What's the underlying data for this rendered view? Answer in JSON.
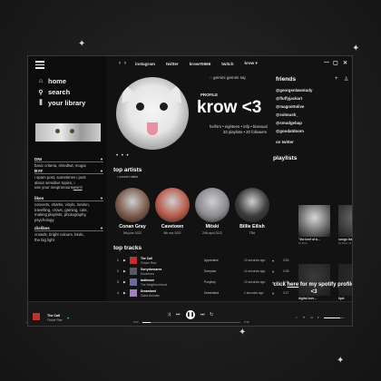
{
  "sidebar": {
    "nav": [
      {
        "label": "home",
        "icon": "home-icon"
      },
      {
        "label": "search",
        "icon": "search-icon"
      },
      {
        "label": "your library",
        "icon": "library-icon"
      }
    ],
    "sections": [
      {
        "title": "DNI",
        "lines": [
          "basic criteria, sh/edtwt, mogai"
        ]
      },
      {
        "title": "BYF",
        "lines": [
          "i spam post, sometimes i post",
          "about sensitive topics, i ",
          "use your neopronouns"
        ],
        "link": "won't"
      },
      {
        "title": "likes",
        "lines": [
          "concerts, sharks, vinyls, london,",
          "travelling, crows, gaming, cats,",
          "making playlists, photography,",
          "psychology"
        ]
      },
      {
        "title": "dislikes",
        "lines": [
          "crowds, bright colours, birds,",
          "the big light"
        ]
      }
    ]
  },
  "topbar": {
    "links": [
      "instagram",
      "twitter",
      "krow#0666",
      "twitch",
      "krow"
    ]
  },
  "profile": {
    "status": "gemini  gemini  saj",
    "label": "PROFILE",
    "name": "krow <3",
    "tags": "he/him • eighteen • infp • bisexual",
    "stats": "33 playlists • 20 followers"
  },
  "top_artists": {
    "title": "top artists",
    "subtitle": "concert dates",
    "items": [
      {
        "name": "Conan Gray",
        "date": "8th june 2022",
        "color": "#7a5a4a"
      },
      {
        "name": "Cavetown",
        "date": "5th nov 2022",
        "color": "#b85a4a"
      },
      {
        "name": "Mitski",
        "date": "20th april 2022",
        "color": "#8a8a90"
      },
      {
        "name": "Billie Eilish",
        "date": "TBA",
        "color": "#3a3a3a"
      }
    ]
  },
  "top_tracks": {
    "title": "top tracks",
    "rows": [
      {
        "num": "1",
        "title": "The Call",
        "artist": "Flower Rise",
        "album": "Apprentice",
        "ago": "10 seconds ago",
        "dur": "3:53",
        "color": "#c03030"
      },
      {
        "num": "2",
        "title": "Sorrydoncares",
        "artist": "Moonbrea",
        "album": "Sorrydon",
        "ago": "10 seconds ago",
        "dur": "4:35",
        "color": "#555a60"
      },
      {
        "num": "3",
        "title": "bathroom",
        "artist": "The Neighbourhood",
        "album": "Ponyboy",
        "ago": "10 seconds ago",
        "dur": "3:09",
        "color": "#6a6aa0"
      },
      {
        "num": "4",
        "title": "Dreamland",
        "artist": "Glass Animals",
        "album": "Dreamland",
        "ago": "1 seconds ago",
        "dur": "3:27",
        "color": "#a080c0"
      }
    ]
  },
  "friends": {
    "title": "friends",
    "handles": [
      "@georgenlawstudy",
      "@fluffyjackart",
      "@magnettolive",
      "@solmush_",
      "@smudgebap",
      "@goodatdoom"
    ],
    "footer": "on twitter"
  },
  "playlists": {
    "title": "playlists",
    "items": [
      {
        "caption": "\"the beef of b...",
        "sub": "by krow",
        "color": "#d8d8d8"
      },
      {
        "caption": "songs that make ...",
        "sub": "by Krow <3",
        "color": "#6a6a6a"
      },
      {
        "caption": "digital love...",
        "sub": "a playlist that is so...",
        "color": "#3a3a3a"
      },
      {
        "caption": "lipd:",
        "sub": "by krow",
        "color": "#2a2a2a"
      }
    ],
    "spotify_prefix": "click ",
    "spotify_link": "here",
    "spotify_suffix": " for my spotify profile <3"
  },
  "player": {
    "title": "The Call",
    "artist": "Flower Rise",
    "elapsed": "0:00",
    "total": "3:18",
    "progress": 0.08,
    "volume": 0.8
  }
}
